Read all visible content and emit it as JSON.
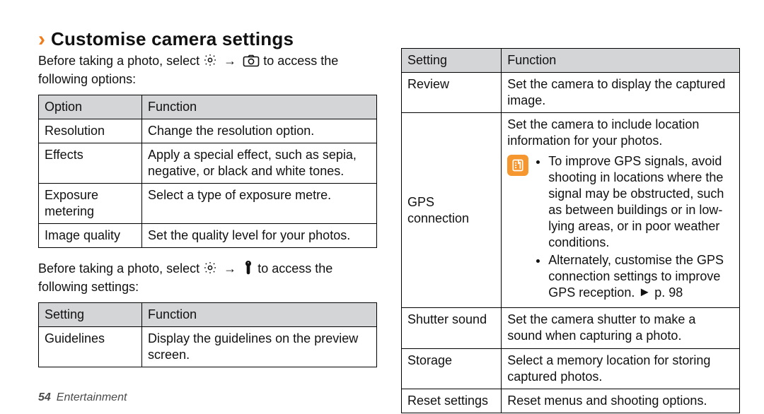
{
  "heading": "Customise camera settings",
  "intro_options_pre": "Before taking a photo, select ",
  "intro_options_post": " to access the following options:",
  "intro_settings_pre": "Before taking a photo, select ",
  "intro_settings_post": " to access the following settings:",
  "arrow": "→",
  "triangle": "►",
  "icons": {
    "gear": "gear-icon",
    "camera": "camera-icon",
    "wrench": "wrench-icon",
    "note": "note-icon"
  },
  "optionsTable": {
    "head": {
      "c0": "Option",
      "c1": "Function"
    },
    "rows": [
      {
        "c0": "Resolution",
        "c1": "Change the resolution option."
      },
      {
        "c0": "Effects",
        "c1": "Apply a special effect, such as sepia, negative, or black and white tones."
      },
      {
        "c0": "Exposure metering",
        "c1": "Select a type of exposure metre."
      },
      {
        "c0": "Image quality",
        "c1": "Set the quality level for your photos."
      }
    ]
  },
  "settingsTableLeft": {
    "head": {
      "c0": "Setting",
      "c1": "Function"
    },
    "rows": [
      {
        "c0": "Guidelines",
        "c1": "Display the guidelines on the preview screen."
      }
    ]
  },
  "settingsTableRight": {
    "head": {
      "c0": "Setting",
      "c1": "Function"
    },
    "rows": [
      {
        "c0": "Review",
        "c1": "Set the camera to display the captured image."
      }
    ],
    "gps": {
      "label": "GPS connection",
      "intro": "Set the camera to include location information for your photos.",
      "b1": "To improve GPS signals, avoid shooting in locations where the signal may be obstructed, such as between buildings or in low-lying areas, or in poor weather conditions.",
      "b2_pre": "Alternately, customise the GPS connection settings to improve GPS reception. ",
      "b2_ref": "p. 98"
    },
    "rows2": [
      {
        "c0": "Shutter sound",
        "c1": "Set the camera shutter to make a sound when capturing a photo."
      },
      {
        "c0": "Storage",
        "c1": "Select a memory location for storing captured photos."
      },
      {
        "c0": "Reset settings",
        "c1": "Reset menus and shooting options."
      }
    ]
  },
  "footer": {
    "page": "54",
    "section": "Entertainment"
  }
}
